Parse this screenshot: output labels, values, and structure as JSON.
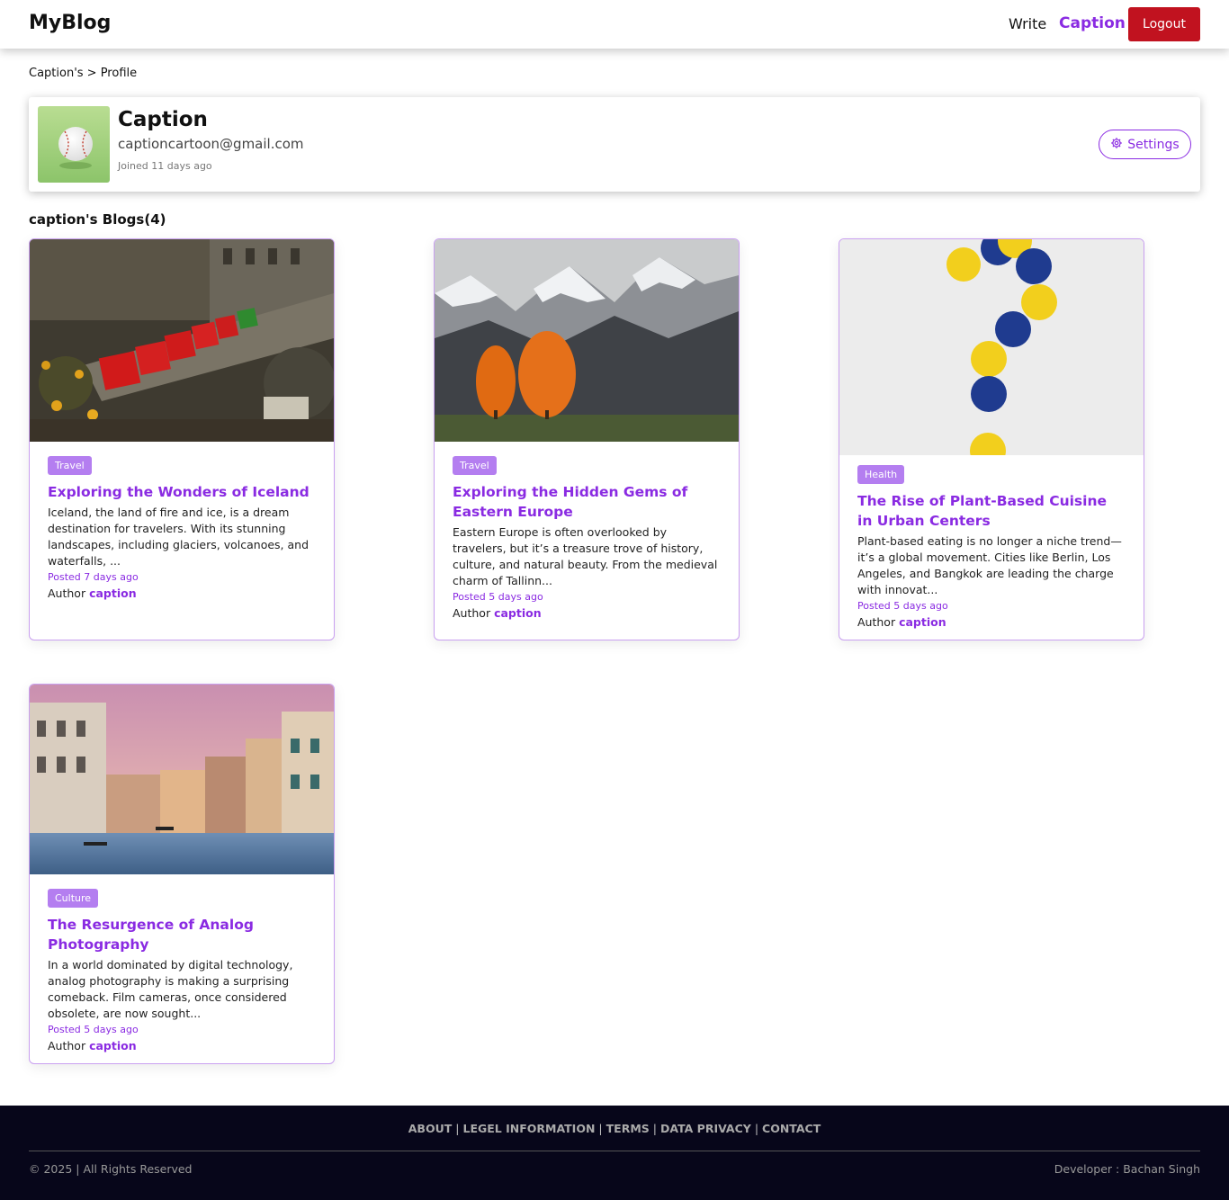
{
  "nav": {
    "brand": "MyBlog",
    "write": "Write",
    "user": "Caption",
    "logout": "Logout"
  },
  "breadcrumb": "Caption's > Profile",
  "profile": {
    "name": "Caption",
    "email": "captioncartoon@gmail.com",
    "joined": "Joined 11 days ago",
    "settings": "Settings"
  },
  "blogs_heading": "caption's Blogs(4)",
  "blogs": [
    {
      "tag": "Travel",
      "title": "Exploring the Wonders of Iceland",
      "desc": "Iceland, the land of fire and ice, is a dream destination for travelers. With its stunning landscapes, including glaciers, volcanoes, and waterfalls, ...",
      "posted": "Posted 7 days ago",
      "author_label": "Author",
      "author": "caption",
      "image": "city-buses-photo"
    },
    {
      "tag": "Travel",
      "title": "Exploring the Hidden Gems of Eastern Europe",
      "desc": "Eastern Europe is often overlooked by travelers, but it’s a treasure trove of history, culture, and natural beauty. From the medieval charm of Tallinn...",
      "posted": "Posted 5 days ago",
      "author_label": "Author",
      "author": "caption",
      "image": "mountain-autumn-photo"
    },
    {
      "tag": "Health",
      "title": "The Rise of Plant-Based Cuisine in Urban Centers",
      "desc": "Plant-based eating is no longer a niche trend—it’s a global movement. Cities like Berlin, Los Angeles, and Bangkok are leading the charge with innovat...",
      "posted": "Posted 5 days ago",
      "author_label": "Author",
      "author": "caption",
      "image": "question-mark-pills-photo"
    },
    {
      "tag": "Culture",
      "title": "The Resurgence of Analog Photography",
      "desc": "In a world dominated by digital technology, analog photography is making a surprising comeback. Film cameras, once considered obsolete, are now sought...",
      "posted": "Posted 5 days ago",
      "author_label": "Author",
      "author": "caption",
      "image": "venice-canal-photo"
    }
  ],
  "footer": {
    "links": [
      "ABOUT",
      "LEGEL INFORMATION",
      "TERMS",
      "DATA PRIVACY",
      "CONTACT"
    ],
    "separator": "|",
    "copyright": "© 2025 | All Rights Reserved",
    "developer": "Developer : Bachan Singh"
  },
  "colors": {
    "accent": "#8a2be2",
    "tag": "#b47ef0",
    "logout": "#c1121f",
    "footer_bg": "#07061a"
  }
}
